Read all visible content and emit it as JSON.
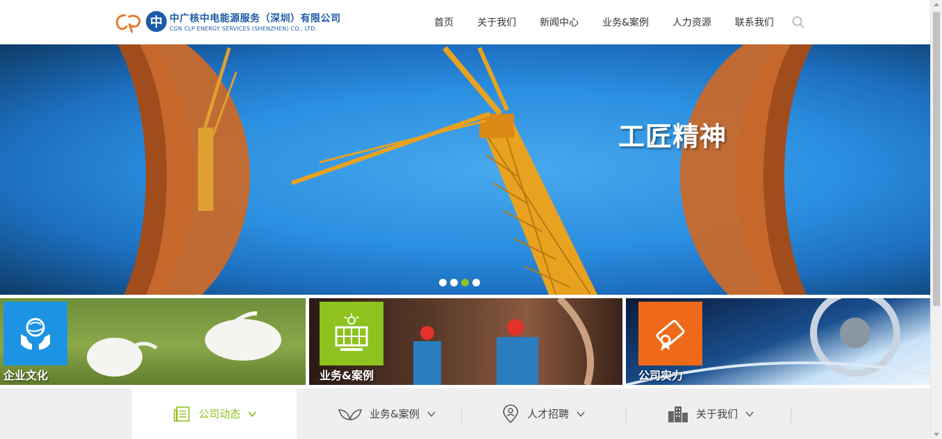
{
  "header": {
    "logo": {
      "cn": "中广核中电能源服务（深圳）有限公司",
      "en": "CGN CLP ENERGY SERVICES (SHENZHEN) CO., LTD.",
      "mark_letter": "中"
    },
    "nav": [
      "首页",
      "关于我们",
      "新闻中心",
      "业务&案例",
      "人力资源",
      "联系我们"
    ]
  },
  "banner": {
    "title": "工匠精神",
    "slide_count": 4,
    "active_slide": 3,
    "active_dot_color": "#8fc31f"
  },
  "tiles": [
    {
      "label": "企业文化",
      "icon": "globe-hands-icon",
      "badge_color": "#1d94e3"
    },
    {
      "label": "业务&案例",
      "icon": "solar-panel-icon",
      "badge_color": "#8dc21f"
    },
    {
      "label": "公司实力",
      "icon": "scroll-certificate-icon",
      "badge_color": "#ee6a1a"
    }
  ],
  "tabs": [
    {
      "label": "公司动态",
      "icon": "news-icon",
      "active": true
    },
    {
      "label": "业务&案例",
      "icon": "leaf-icon",
      "active": false
    },
    {
      "label": "人才招聘",
      "icon": "location-person-icon",
      "active": false
    },
    {
      "label": "关于我们",
      "icon": "buildings-icon",
      "active": false
    }
  ],
  "colors": {
    "brand_blue": "#1a5aa6",
    "accent_green": "#8dc21f",
    "accent_orange": "#ee6a1a",
    "accent_blue": "#1d94e3"
  }
}
